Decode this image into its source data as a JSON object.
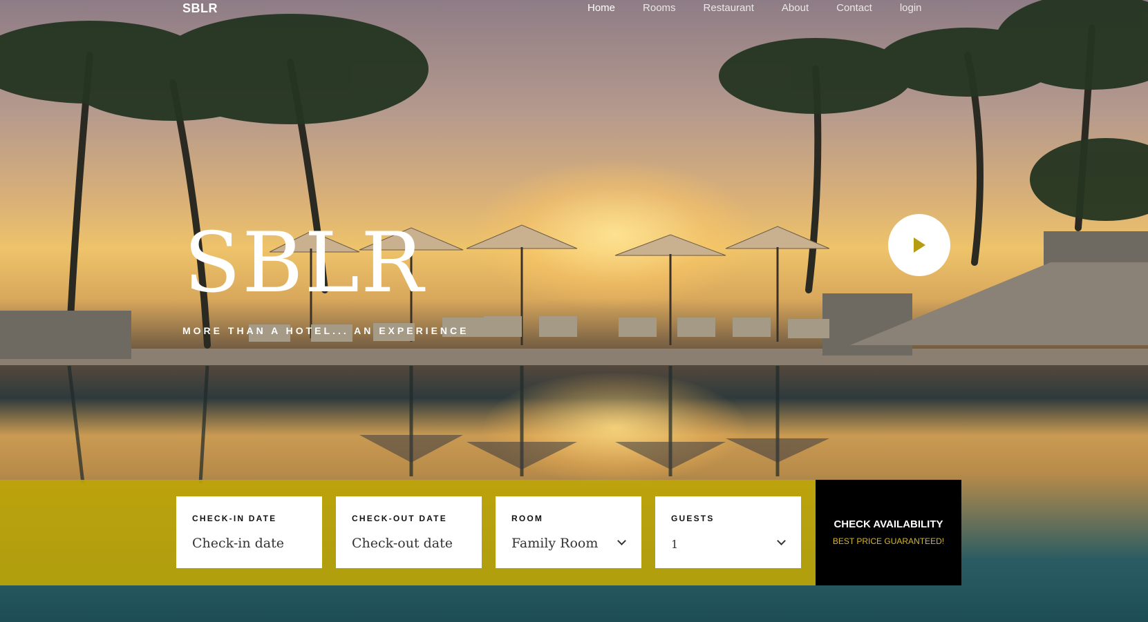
{
  "nav": {
    "brand": "SBLR",
    "links": [
      "Home",
      "Rooms",
      "Restaurant",
      "About",
      "Contact",
      "login"
    ],
    "active": "Home"
  },
  "hero": {
    "title": "SBLR",
    "tagline": "MORE THAN A HOTEL... AN EXPERIENCE"
  },
  "booking": {
    "checkin": {
      "label": "CHECK-IN DATE",
      "placeholder": "Check-in date"
    },
    "checkout": {
      "label": "CHECK-OUT DATE",
      "placeholder": "Check-out date"
    },
    "room": {
      "label": "ROOM",
      "value": "Family Room"
    },
    "guests": {
      "label": "GUESTS",
      "value": "1"
    },
    "cta": {
      "title": "CHECK AVAILABILITY",
      "subtitle": "BEST PRICE GUARANTEED!"
    }
  },
  "colors": {
    "accent": "#BEA508",
    "cta_bg": "#000000",
    "cta_sub": "#D4B72A"
  },
  "icons": {
    "play": "play-icon",
    "select": "chevron-down-icon"
  }
}
